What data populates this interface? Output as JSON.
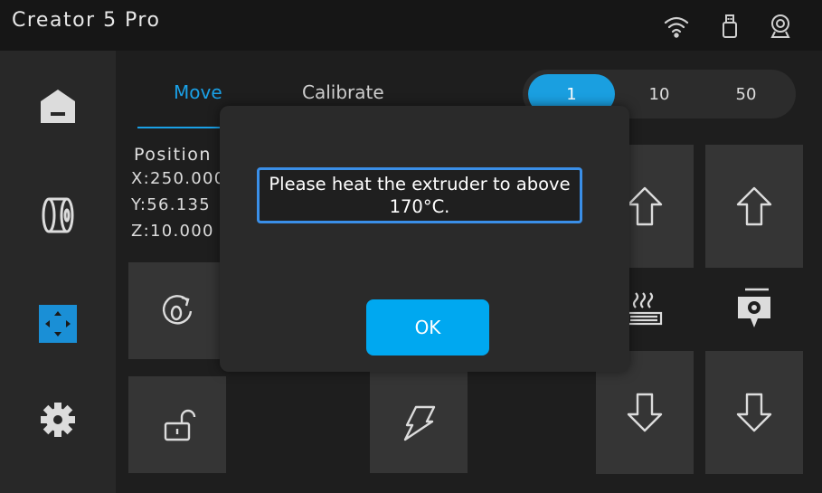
{
  "header": {
    "title": "Creator 5 Pro"
  },
  "status_icons": [
    "wifi-icon",
    "usb-drive-icon",
    "webcam-icon"
  ],
  "sidebar": {
    "items": [
      "home-icon",
      "filament-spool-icon",
      "move-axes-icon",
      "gear-icon"
    ],
    "active_index": 2
  },
  "tabs": [
    {
      "label": "Move",
      "active": true
    },
    {
      "label": "Calibrate",
      "active": false
    }
  ],
  "steps": {
    "options": [
      "1",
      "10",
      "50"
    ],
    "selected": "1"
  },
  "position": {
    "label": "Position",
    "x": "X:250.000",
    "y": "Y:56.135",
    "z": "Z:10.000"
  },
  "controls": [
    "rotate-zero-icon",
    "unlock-icon",
    "nozzle-arrow-icon",
    "arrow-up-icon",
    "arrow-up-icon",
    "heated-bed-icon",
    "extruder-settings-icon",
    "arrow-down-icon",
    "arrow-down-icon"
  ],
  "dialog": {
    "message": "Please heat the extruder to above 170°C.",
    "ok_label": "OK"
  },
  "colors": {
    "accent": "#1aa0e6",
    "ok_button": "#00a8f0",
    "dialog_border": "#3a8fe8"
  }
}
